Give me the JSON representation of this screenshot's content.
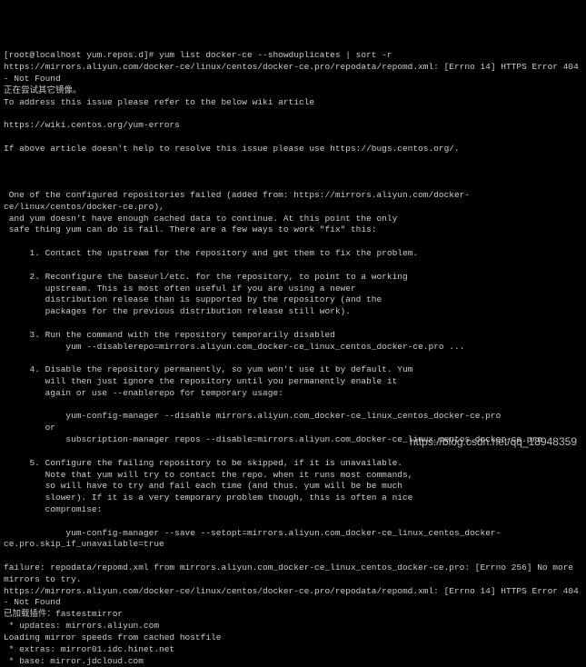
{
  "prompt": "[root@localhost yum.repos.d]# ",
  "command": "yum list docker-ce --showduplicates | sort -r",
  "error_line1": "https://mirrors.aliyun.com/docker-ce/linux/centos/docker-ce.pro/repodata/repomd.xml: [Errno 14] HTTPS Error 404 - Not Found",
  "cn_line": "正在尝试其它镜像。",
  "addr_line": "To address this issue please refer to the below wiki article",
  "wiki_url": "https://wiki.centos.org/yum-errors",
  "help_line": "If above article doesn't help to resolve this issue please use https://bugs.centos.org/.",
  "intro1": " One of the configured repositories failed (added from: https://mirrors.aliyun.com/docker-ce/linux/centos/docker-ce.pro),",
  "intro2": " and yum doesn't have enough cached data to continue. At this point the only",
  "intro3": " safe thing yum can do is fail. There are a few ways to work \"fix\" this:",
  "step1": "     1. Contact the upstream for the repository and get them to fix the problem.",
  "step2a": "     2. Reconfigure the baseurl/etc. for the repository, to point to a working",
  "step2b": "        upstream. This is most often useful if you are using a newer",
  "step2c": "        distribution release than is supported by the repository (and the",
  "step2d": "        packages for the previous distribution release still work).",
  "step3a": "     3. Run the command with the repository temporarily disabled",
  "step3b": "            yum --disablerepo=mirrors.aliyun.com_docker-ce_linux_centos_docker-ce.pro ...",
  "step4a": "     4. Disable the repository permanently, so yum won't use it by default. Yum",
  "step4b": "        will then just ignore the repository until you permanently enable it",
  "step4c": "        again or use --enablerepo for temporary usage:",
  "step4d": "            yum-config-manager --disable mirrors.aliyun.com_docker-ce_linux_centos_docker-ce.pro",
  "step4e": "        or",
  "step4f": "            subscription-manager repos --disable=mirrors.aliyun.com_docker-ce_linux_centos_docker-ce.pro",
  "step5a": "     5. Configure the failing repository to be skipped, if it is unavailable.",
  "step5b": "        Note that yum will try to contact the repo. when it runs most commands,",
  "step5c": "        so will have to try and fail each time (and thus. yum will be be much",
  "step5d": "        slower). If it is a very temporary problem though, this is often a nice",
  "step5e": "        compromise:",
  "step5f": "            yum-config-manager --save --setopt=mirrors.aliyun.com_docker-ce_linux_centos_docker-ce.pro.skip_if_unavailable=true",
  "fail1": "failure: repodata/repomd.xml from mirrors.aliyun.com_docker-ce_linux_centos_docker-ce.pro: [Errno 256] No more mirrors to try.",
  "fail2": "https://mirrors.aliyun.com/docker-ce/linux/centos/docker-ce.pro/repodata/repomd.xml: [Errno 14] HTTPS Error 404 - Not Found",
  "plugin": "已加载插件：fastestmirror",
  "updates": " * updates: mirrors.aliyun.com",
  "loading": "Loading mirror speeds from cached hostfile",
  "extras": " * extras: mirror01.idc.hinet.net",
  "base": " * base: mirror.jdcloud.com",
  "watermark": "https://blog.csdn.net/qq_18948359"
}
